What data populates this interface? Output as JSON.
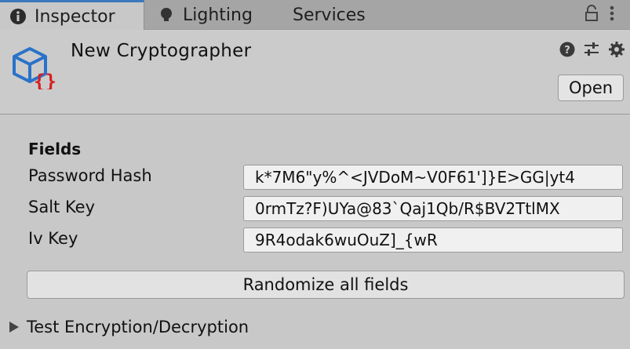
{
  "tabs": [
    {
      "label": "Inspector",
      "icon": "info-icon",
      "active": true
    },
    {
      "label": "Lighting",
      "icon": "lightbulb-icon",
      "active": false
    },
    {
      "label": "Services",
      "icon": "",
      "active": false
    }
  ],
  "tabbar_tools": [
    "lock-icon",
    "kebab-menu-icon"
  ],
  "header": {
    "asset_name": "New Cryptographer",
    "asset_icon": "scriptable-object-icon",
    "tools": [
      "help-icon",
      "preset-icon",
      "settings-icon"
    ],
    "open_label": "Open"
  },
  "fields_section": {
    "title": "Fields",
    "fields": [
      {
        "label": "Password Hash",
        "value": "k*7M6\"y%^<JVDoM~V0F61']}E>GG|yt4"
      },
      {
        "label": "Salt Key",
        "value": "0rmTz?F)UYa@83`Qaj1Qb/R$BV2TtlMX"
      },
      {
        "label": "Iv Key",
        "value": "9R4odak6wuOuZ]_{wR"
      }
    ],
    "randomize_label": "Randomize all fields"
  },
  "foldout": {
    "label": "Test Encryption/Decryption",
    "expanded": false
  },
  "colors": {
    "tab_accent": "#3a79bb",
    "asset_icon_blue": "#2a72c9",
    "asset_icon_red": "#d61f1f"
  }
}
